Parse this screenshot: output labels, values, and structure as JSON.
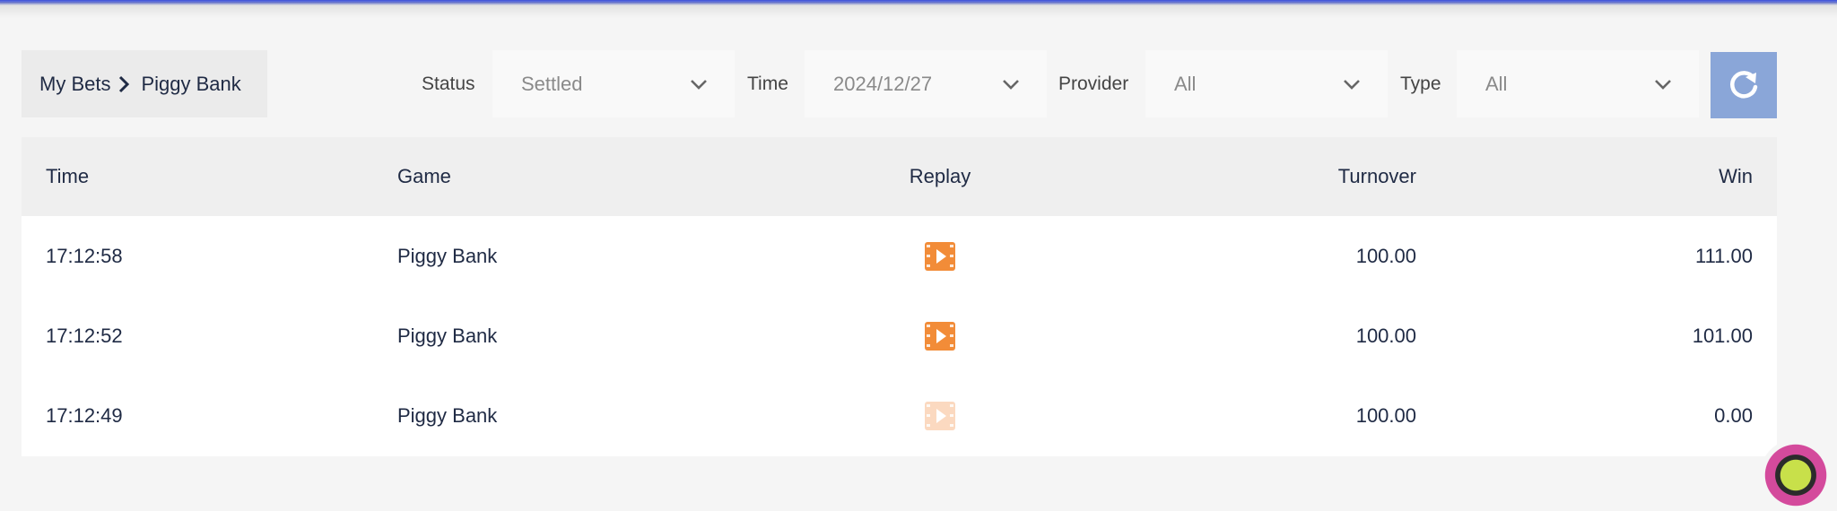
{
  "breadcrumb": {
    "root": "My Bets",
    "current": "Piggy Bank"
  },
  "filters": {
    "status": {
      "label": "Status",
      "value": "Settled"
    },
    "time": {
      "label": "Time",
      "value": "2024/12/27"
    },
    "provider": {
      "label": "Provider",
      "value": "All"
    },
    "type": {
      "label": "Type",
      "value": "All"
    }
  },
  "table": {
    "headers": {
      "time": "Time",
      "game": "Game",
      "replay": "Replay",
      "turnover": "Turnover",
      "win": "Win"
    },
    "rows": [
      {
        "time": "17:12:58",
        "game": "Piggy Bank",
        "turnover": "100.00",
        "win": "111.00",
        "replay_enabled": true
      },
      {
        "time": "17:12:52",
        "game": "Piggy Bank",
        "turnover": "100.00",
        "win": "101.00",
        "replay_enabled": true
      },
      {
        "time": "17:12:49",
        "game": "Piggy Bank",
        "turnover": "100.00",
        "win": "0.00",
        "replay_enabled": false
      }
    ]
  },
  "colors": {
    "accent": "#f28c38",
    "refresh_bg": "#8aa6d8",
    "topbar": "#3b4fd6"
  },
  "icons": {
    "breadcrumb_sep": "chevron-right-icon",
    "select": "chevron-down-icon",
    "refresh": "refresh-icon",
    "replay": "video-play-icon"
  }
}
